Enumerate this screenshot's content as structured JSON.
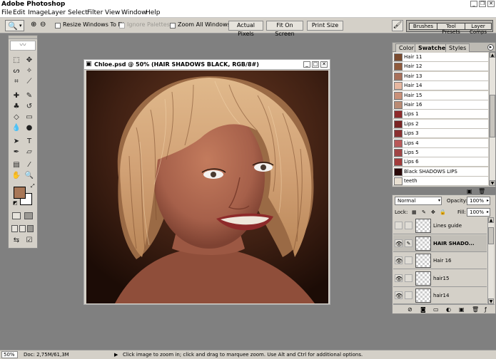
{
  "app": {
    "title": "Adobe Photoshop"
  },
  "menu": [
    "File",
    "Edit",
    "Image",
    "Layer",
    "Select",
    "Filter",
    "View",
    "Window",
    "Help"
  ],
  "options": {
    "resize_windows": "Resize Windows To Fit",
    "ignore_palettes": "Ignore Palettes",
    "zoom_all": "Zoom All Windows",
    "actual_pixels": "Actual Pixels",
    "fit_on_screen": "Fit On Screen",
    "print_size": "Print Size",
    "well_tabs": [
      "Brushes",
      "Tool Presets",
      "Layer Comps"
    ]
  },
  "document": {
    "title": "Chloe.psd @ 50% (HAIR SHADOWS BLACK, RGB/8#)"
  },
  "colors": {
    "foreground": "#a87757",
    "background": "#ffffff"
  },
  "swatches_palette": {
    "tabs": [
      "Color",
      "Swatches",
      "Styles"
    ],
    "active_tab": "Swatches",
    "items": [
      {
        "name": "Hair 11",
        "color": "#7a4a2e"
      },
      {
        "name": "Hair 12",
        "color": "#8f5a3c"
      },
      {
        "name": "Hair 13",
        "color": "#a8705a"
      },
      {
        "name": "Hair 14",
        "color": "#e6b7a0"
      },
      {
        "name": "Hair 15",
        "color": "#c99078"
      },
      {
        "name": "Hair 16",
        "color": "#b98a73"
      },
      {
        "name": "Lips 1",
        "color": "#8e2a2a"
      },
      {
        "name": "Lips 2",
        "color": "#7a2424"
      },
      {
        "name": "Lips 3",
        "color": "#8a3030"
      },
      {
        "name": "Lips 4",
        "color": "#b85858"
      },
      {
        "name": "Lips 5",
        "color": "#a04545"
      },
      {
        "name": "Lips 6",
        "color": "#a23c3c"
      },
      {
        "name": "Black SHADOWS LIPS",
        "color": "#2a0808"
      },
      {
        "name": "teeth",
        "color": "#e9e0d2"
      }
    ]
  },
  "layers_palette": {
    "blend_mode": "Normal",
    "opacity_label": "Opacity:",
    "opacity": "100%",
    "lock_label": "Lock:",
    "fill_label": "Fill:",
    "fill": "100%",
    "layers": [
      {
        "name": "Lines guide",
        "visible": false,
        "selected": false
      },
      {
        "name": "HAIR SHADO...",
        "visible": true,
        "selected": true
      },
      {
        "name": "Hair 16",
        "visible": true,
        "selected": false
      },
      {
        "name": "hair15",
        "visible": true,
        "selected": false
      },
      {
        "name": "hair14",
        "visible": true,
        "selected": false
      }
    ]
  },
  "status": {
    "zoom": "50%",
    "doc": "Doc: 2,75M/61,3M",
    "hint": "Click image to zoom in; click and drag to marquee zoom.  Use Alt and Ctrl for additional options."
  },
  "icons": {
    "zoom_tool": "zoom-icon",
    "minimize": "minimize-icon",
    "maximize": "maximize-icon",
    "close": "close-icon",
    "eye": "eye-icon",
    "brush": "brush-icon",
    "play": "play-icon",
    "palette_menu": "palette-menu-icon"
  }
}
